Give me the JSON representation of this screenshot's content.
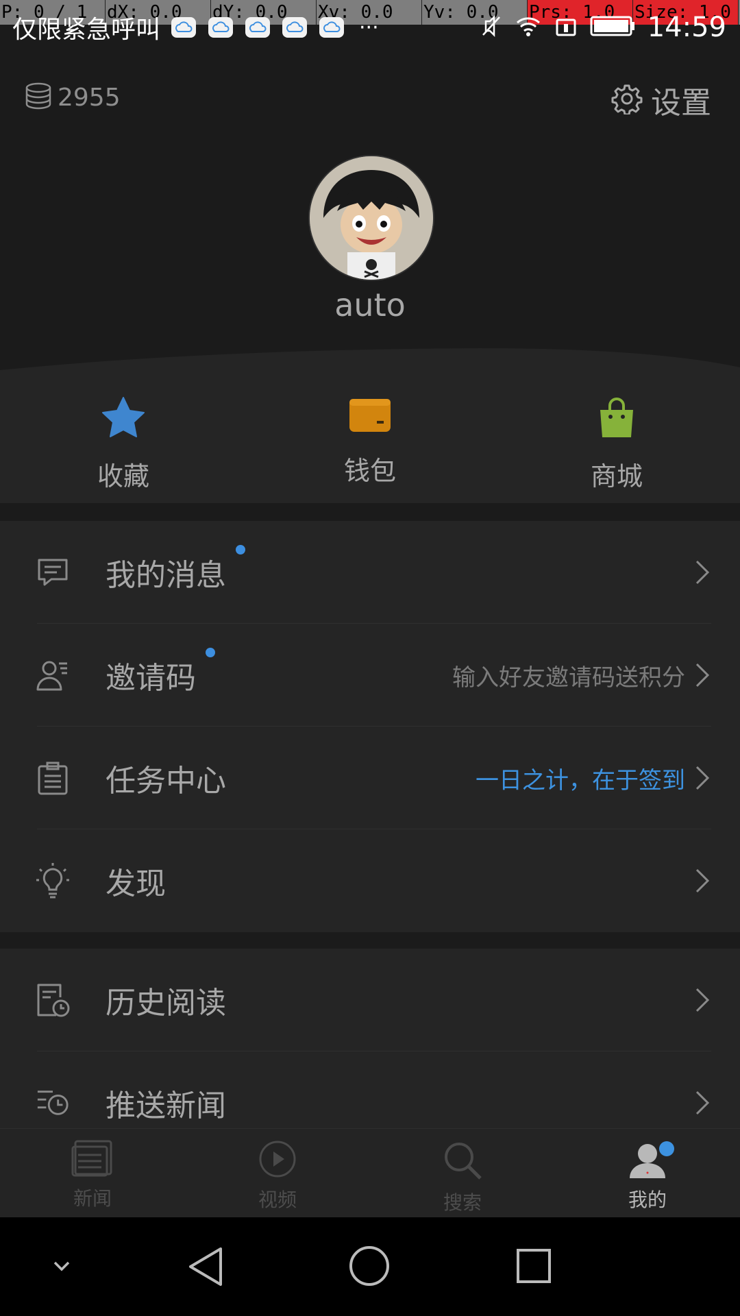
{
  "debug": [
    "P: 0 / 1",
    "dX: 0.0",
    "dY: 0.0",
    "Xv: 0.0",
    "Yv: 0.0",
    "Prs: 1.0",
    "Size: 1.0"
  ],
  "status_bar": {
    "carrier": "仅限紧急呼叫",
    "more": "···",
    "time": "14:59",
    "notification_icons": [
      "cloud-icon",
      "cloud-icon",
      "cloud-icon",
      "cloud-icon",
      "cloud-icon"
    ],
    "indicator_icons": [
      "mute-icon",
      "wifi-icon",
      "sim-icon",
      "battery-icon"
    ]
  },
  "header": {
    "coins": "2955",
    "settings_label": "设置",
    "username": "auto"
  },
  "quick_actions": [
    {
      "label": "收藏",
      "icon": "star-icon",
      "color": "#3f86cf"
    },
    {
      "label": "钱包",
      "icon": "wallet-icon",
      "color": "#d2850e"
    },
    {
      "label": "商城",
      "icon": "shopping-bag-icon",
      "color": "#86b23a"
    }
  ],
  "menu_group_1": [
    {
      "label": "我的消息",
      "hint": "",
      "icon": "message-icon",
      "dot": true
    },
    {
      "label": "邀请码",
      "hint": "输入好友邀请码送积分",
      "icon": "invite-icon",
      "dot": true
    },
    {
      "label": "任务中心",
      "hint": "一日之计，在于签到",
      "icon": "task-icon",
      "dot": false
    },
    {
      "label": "发现",
      "hint": "",
      "icon": "lightbulb-icon",
      "dot": false
    }
  ],
  "menu_group_2": [
    {
      "label": "历史阅读",
      "icon": "history-icon"
    },
    {
      "label": "推送新闻",
      "icon": "push-news-icon"
    }
  ],
  "tabs": [
    {
      "label": "新闻",
      "icon": "news-icon"
    },
    {
      "label": "视频",
      "icon": "video-icon"
    },
    {
      "label": "搜索",
      "icon": "search-icon"
    },
    {
      "label": "我的",
      "icon": "profile-icon"
    }
  ],
  "colors": {
    "accent": "#3d92e0",
    "background": "#1b1b1b",
    "card": "#252525"
  }
}
